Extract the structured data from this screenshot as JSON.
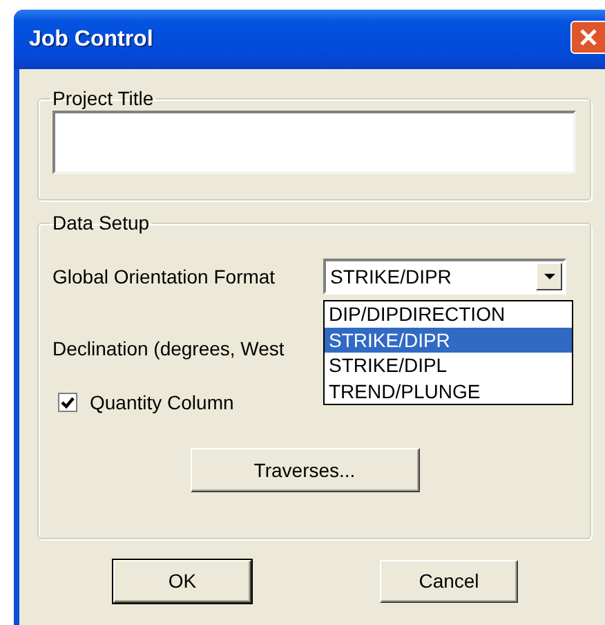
{
  "window": {
    "title": "Job Control"
  },
  "project_title": {
    "legend": "Project Title"
  },
  "data_setup": {
    "legend": "Data Setup",
    "orientation_format": {
      "label": "Global Orientation Format",
      "value": "STRIKE/DIPR",
      "expanded": true,
      "options": [
        {
          "label": "DIP/DIPDIRECTION",
          "selected": false
        },
        {
          "label": "STRIKE/DIPR",
          "selected": true
        },
        {
          "label": "STRIKE/DIPL",
          "selected": false
        },
        {
          "label": "TREND/PLUNGE",
          "selected": false
        }
      ]
    },
    "declination": {
      "label": "Declination (degrees, West"
    },
    "quantity_column": {
      "label": "Quantity Column",
      "checked": true
    },
    "traverses_button": "Traverses..."
  },
  "buttons": [
    {
      "label": "OK",
      "default": true
    },
    {
      "label": "Cancel",
      "default": false
    }
  ]
}
